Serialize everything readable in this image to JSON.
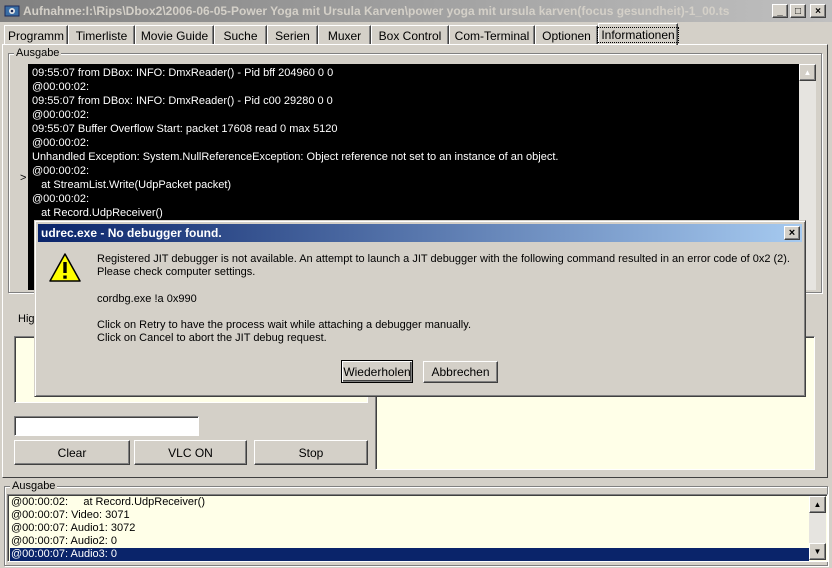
{
  "window": {
    "title": "Aufnahme:I:\\Rips\\Dbox2\\2006-06-05-Power Yoga mit Ursula Karven\\power yoga mit ursula karven(focus gesundheit)-1_00.ts",
    "minimize_glyph": "_",
    "maximize_glyph": "□",
    "close_glyph": "×"
  },
  "tabs": [
    {
      "label": "Programm"
    },
    {
      "label": "Timerliste"
    },
    {
      "label": "Movie Guide"
    },
    {
      "label": "Suche"
    },
    {
      "label": "Serien"
    },
    {
      "label": "Muxer"
    },
    {
      "label": "Box Control"
    },
    {
      "label": "Com-Terminal"
    },
    {
      "label": "Optionen"
    },
    {
      "label": "Informationen"
    }
  ],
  "active_tab": "Informationen",
  "output_group": {
    "label": "Ausgabe",
    "current_line_marker": ">",
    "lines": [
      "09:55:07 from DBox: INFO: DmxReader() - Pid bff 204960 0 0",
      "@00:00:02:",
      "09:55:07 from DBox: INFO: DmxReader() - Pid c00 29280 0 0",
      "@00:00:02:",
      "09:55:07 Buffer Overflow Start: packet 17608 read 0 max 5120",
      "@00:00:02:",
      "Unhandled Exception: System.NullReferenceException: Object reference not set to an instance of an object.",
      "@00:00:02:",
      "   at StreamList.Write(UdpPacket packet)",
      "@00:00:02:",
      "   at Record.UdpReceiver()"
    ]
  },
  "left_panel": {
    "highlight_label": "Hig",
    "input_value": "",
    "buttons": {
      "clear": "Clear",
      "vlc": "VLC ON",
      "stop": "Stop"
    }
  },
  "log_group": {
    "label": "Ausgabe",
    "lines": [
      "@00:00:02:     at Record.UdpReceiver()",
      "@00:00:07: Video: 3071",
      "@00:00:07: Audio1: 3072",
      "@00:00:07: Audio2: 0",
      "@00:00:07: Audio3: 0"
    ],
    "selected_index": 4
  },
  "dialog": {
    "title": "udrec.exe - No debugger found.",
    "close_glyph": "×",
    "message_line1": "Registered JIT debugger is not available.  An attempt to launch a JIT debugger with the following command resulted in an error code of 0x2 (2).",
    "message_line2": "Please check computer settings.",
    "command": "cordbg.exe !a 0x990",
    "retry_hint": "Click on Retry to have the process wait while attaching a debugger manually.",
    "cancel_hint": "Click on Cancel to abort the JIT debug request.",
    "retry_button": "Wiederholen",
    "cancel_button": "Abbrechen"
  }
}
